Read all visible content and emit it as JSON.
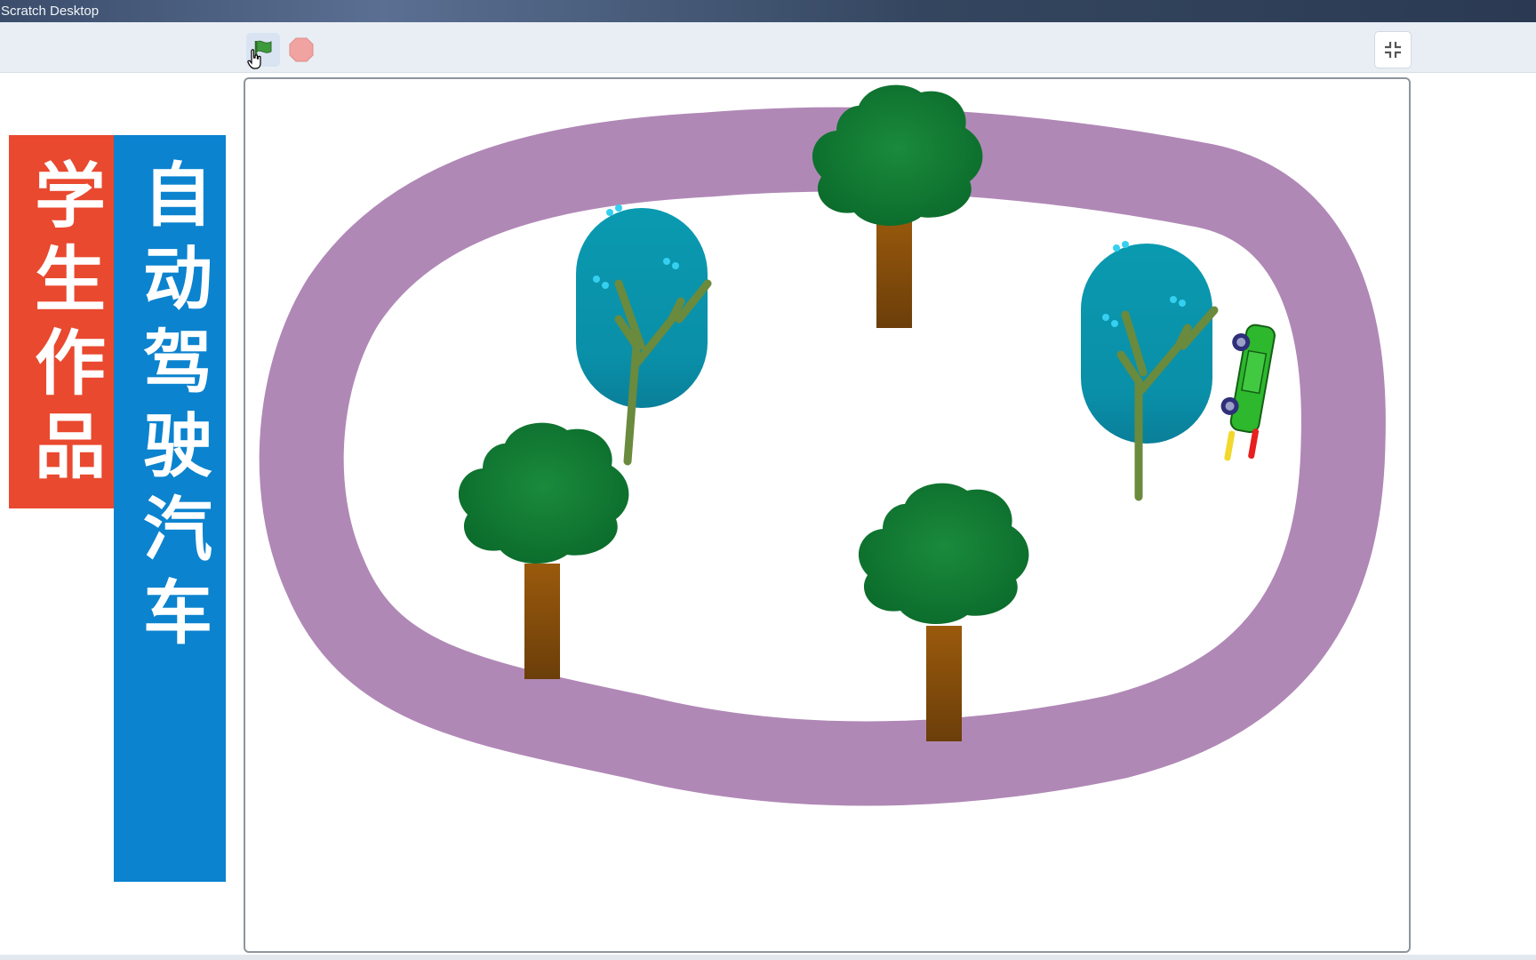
{
  "window": {
    "title": "Scratch Desktop"
  },
  "toolbar": {
    "green_flag": {
      "icon": "green-flag-icon",
      "color": "#3c9a3a"
    },
    "stop": {
      "icon": "stop-icon",
      "color": "#f0a3a0"
    },
    "fullscreen_toggle": {
      "icon": "exit-fullscreen-icon"
    }
  },
  "banners": {
    "left": {
      "text": "学生作品",
      "color": "#e9492f"
    },
    "right": {
      "text": "自动驾驶汽车",
      "color": "#0b83cf"
    }
  },
  "stage": {
    "background": "#ffffff",
    "track_color": "#b088b6",
    "sprites": [
      "tree",
      "tree",
      "tree",
      "blue-tree",
      "blue-tree",
      "car"
    ]
  }
}
